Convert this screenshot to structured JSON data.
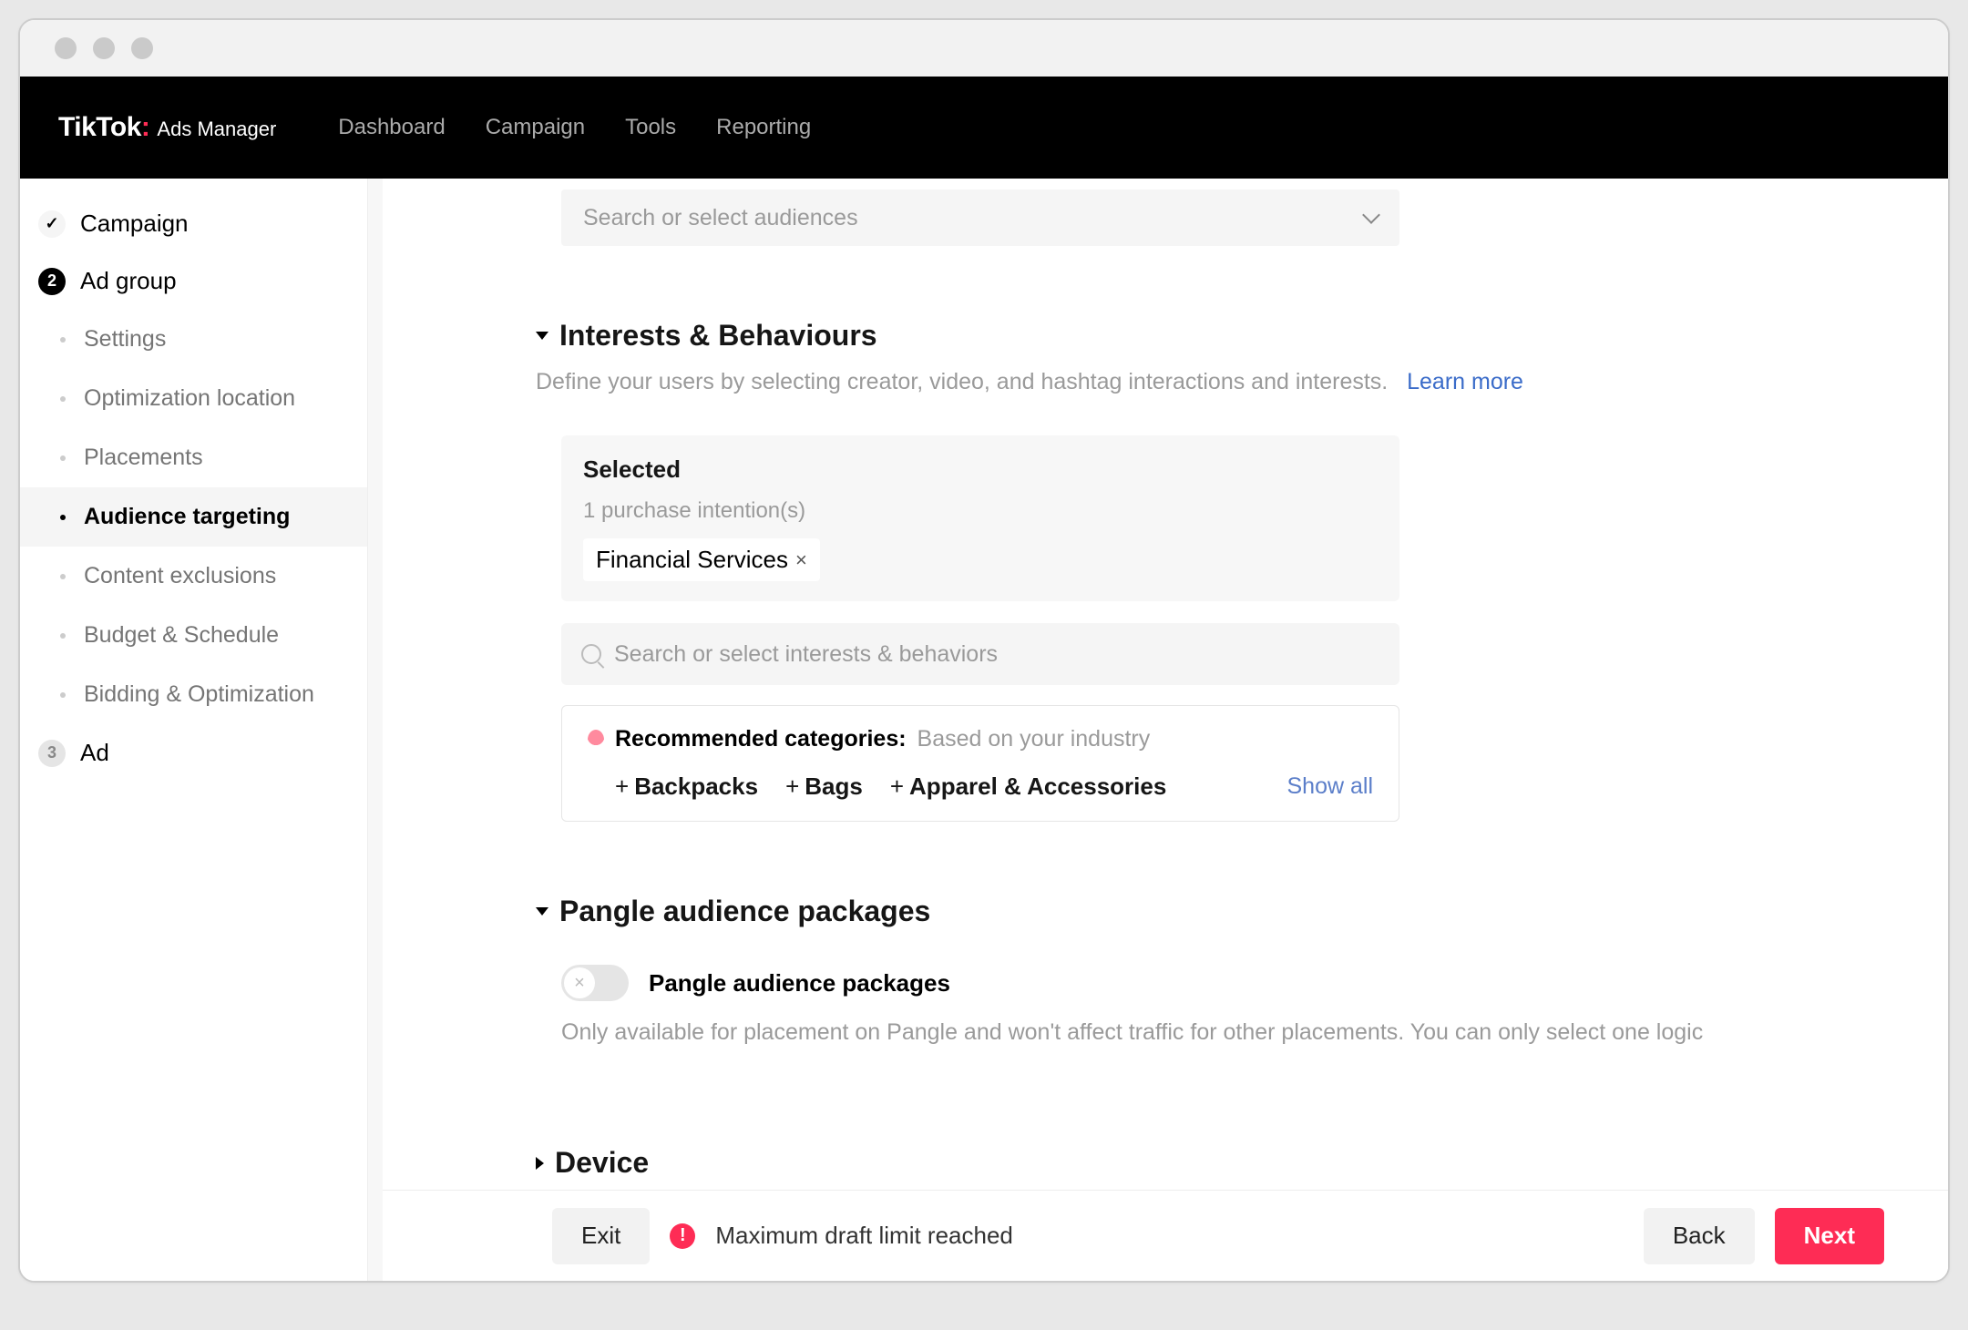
{
  "header": {
    "logo_main": "TikTok",
    "logo_sub": "Ads Manager",
    "nav": [
      "Dashboard",
      "Campaign",
      "Tools",
      "Reporting"
    ]
  },
  "sidebar": {
    "steps": [
      {
        "label": "Campaign",
        "badge": "✓",
        "style": "check"
      },
      {
        "label": "Ad group",
        "badge": "2",
        "style": "dark"
      },
      {
        "label": "Ad",
        "badge": "3",
        "style": "grey"
      }
    ],
    "subitems": [
      "Settings",
      "Optimization location",
      "Placements",
      "Audience targeting",
      "Content exclusions",
      "Budget & Schedule",
      "Bidding & Optimization"
    ],
    "active_sub": "Audience targeting"
  },
  "audiences": {
    "placeholder": "Search or select audiences"
  },
  "interests": {
    "title": "Interests & Behaviours",
    "description": "Define your users by selecting creator, video, and hashtag interactions and interests.",
    "learn_more": "Learn more",
    "selected_label": "Selected",
    "selected_count": "1 purchase intention(s)",
    "chips": [
      "Financial Services"
    ],
    "search_placeholder": "Search or select interests & behaviors",
    "rec_label": "Recommended categories:",
    "rec_basis": "Based on your industry",
    "rec_items": [
      "Backpacks",
      "Bags",
      "Apparel & Accessories"
    ],
    "show_all": "Show all"
  },
  "pangle": {
    "title": "Pangle audience packages",
    "toggle_label": "Pangle audience packages",
    "description": "Only available for placement on Pangle and won't affect traffic for other placements. You can only select one logic"
  },
  "device": {
    "title": "Device"
  },
  "footer": {
    "exit": "Exit",
    "warning": "Maximum draft limit reached",
    "back": "Back",
    "next": "Next"
  }
}
